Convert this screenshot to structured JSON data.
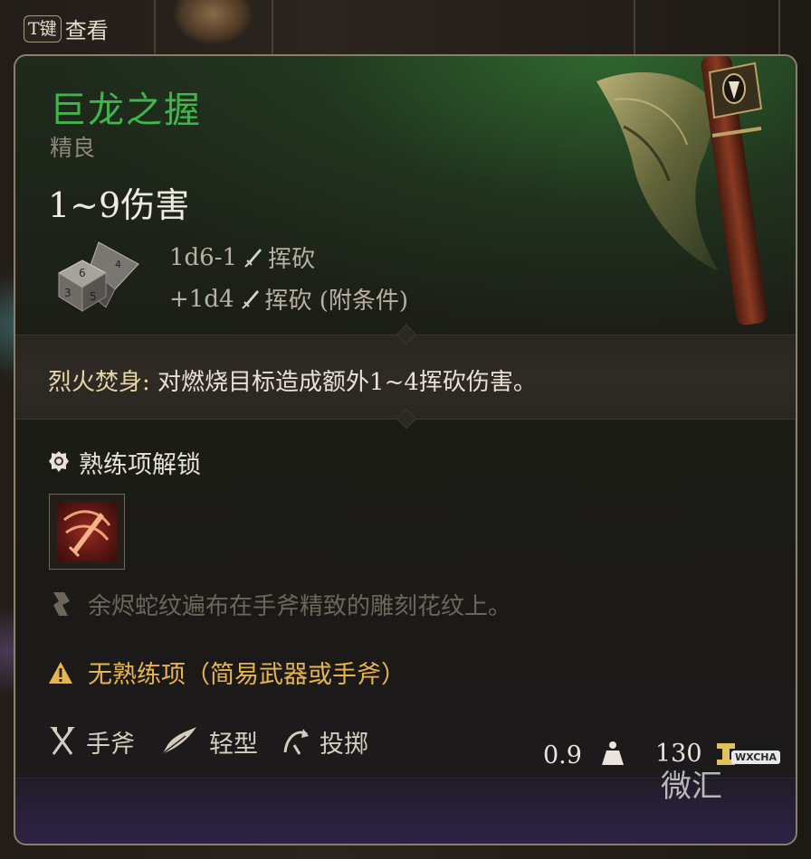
{
  "view_hint": {
    "key": "T键",
    "label": "查看"
  },
  "item": {
    "name": "巨龙之握",
    "rarity": "精良",
    "damage_summary": "1~9伤害",
    "damage_lines": [
      {
        "dice": "1d6-1",
        "type": "挥砍"
      },
      {
        "dice": "+1d4",
        "type": "挥砍 (附条件)"
      }
    ],
    "passive": {
      "name": "烈火焚身",
      "separator": ":",
      "text": "对燃烧目标造成额外1~4挥砍伤害。"
    },
    "proficiency_header": "熟练项解锁",
    "description": "余烬蛇纹遍布在手斧精致的雕刻花纹上。",
    "warning": "无熟练项（简易武器或手斧）",
    "properties": [
      {
        "label": "手斧",
        "icon": "crossed-axes-icon"
      },
      {
        "label": "轻型",
        "icon": "feather-icon"
      },
      {
        "label": "投掷",
        "icon": "throw-icon"
      }
    ],
    "weight": "0.9",
    "price": "130"
  },
  "watermark": {
    "text": "微汇",
    "tag": "WXCHA"
  },
  "colors": {
    "name": "#3fb54a",
    "warning": "#e7b54c",
    "rarity": "#8f887b",
    "description": "#6c665c"
  }
}
